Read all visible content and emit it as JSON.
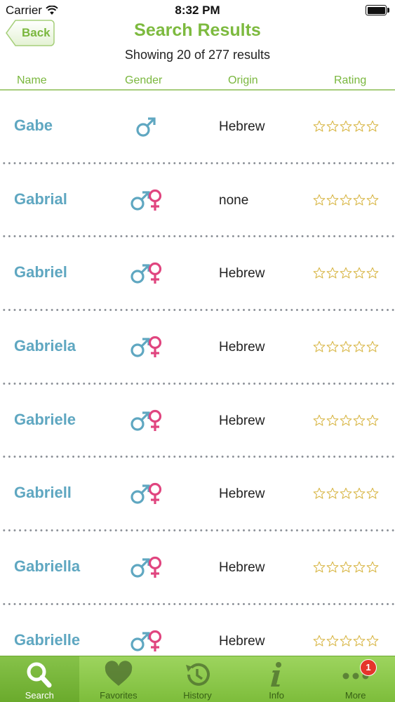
{
  "status_bar": {
    "carrier": "Carrier",
    "time": "8:32 PM"
  },
  "nav": {
    "back_label": "Back",
    "title": "Search Results",
    "summary": "Showing 20 of 277 results"
  },
  "columns": {
    "name": "Name",
    "gender": "Gender",
    "origin": "Origin",
    "rating": "Rating"
  },
  "results": [
    {
      "name": "Gabe",
      "gender": "male",
      "origin": "Hebrew",
      "rating": 0
    },
    {
      "name": "Gabrial",
      "gender": "unisex",
      "origin": "none",
      "rating": 0
    },
    {
      "name": "Gabriel",
      "gender": "unisex",
      "origin": "Hebrew",
      "rating": 0
    },
    {
      "name": "Gabriela",
      "gender": "unisex",
      "origin": "Hebrew",
      "rating": 0
    },
    {
      "name": "Gabriele",
      "gender": "unisex",
      "origin": "Hebrew",
      "rating": 0
    },
    {
      "name": "Gabriell",
      "gender": "unisex",
      "origin": "Hebrew",
      "rating": 0
    },
    {
      "name": "Gabriella",
      "gender": "unisex",
      "origin": "Hebrew",
      "rating": 0
    },
    {
      "name": "Gabrielle",
      "gender": "unisex",
      "origin": "Hebrew",
      "rating": 0
    }
  ],
  "rating_max": 5,
  "tabs": [
    {
      "label": "Search",
      "icon": "search-icon",
      "active": true
    },
    {
      "label": "Favorites",
      "icon": "heart-icon",
      "active": false
    },
    {
      "label": "History",
      "icon": "history-icon",
      "active": false
    },
    {
      "label": "Info",
      "icon": "info-icon",
      "active": false
    },
    {
      "label": "More",
      "icon": "more-icon",
      "active": false,
      "badge": "1"
    }
  ],
  "colors": {
    "accent_green": "#7dba3f",
    "name_blue": "#5fa7c1",
    "male_blue": "#5fa7c1",
    "female_pink": "#e0457f",
    "star_outline": "#d9b84a",
    "badge_red": "#e5352b"
  }
}
